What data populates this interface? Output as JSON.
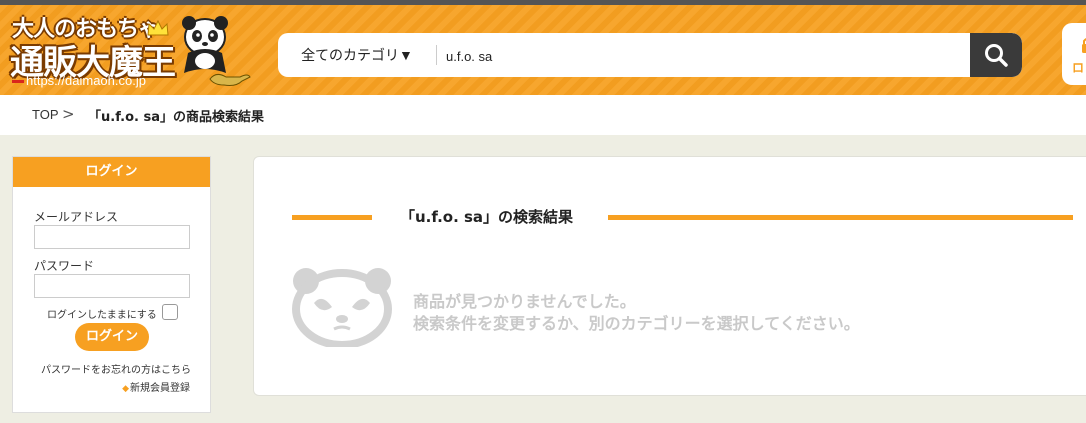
{
  "header": {
    "logo_line1": "大人のおもちゃ",
    "logo_line2": "通販大魔王",
    "logo_url": "https://daimaoh.co.jp",
    "category_select": "全てのカテゴリ▼",
    "search_value": "u.f.o. sa",
    "login_label": "ロ"
  },
  "breadcrumb": {
    "top": "TOP",
    "separator": ">",
    "current": "「u.f.o. sa」の商品検索結果"
  },
  "sidebar": {
    "title": "ログイン",
    "email_label": "メールアドレス",
    "password_label": "パスワード",
    "remember_label": "ログインしたままにする",
    "login_button": "ログイン",
    "forgot_link": "パスワードをお忘れの方はこちら",
    "signup_link": "新規会員登録"
  },
  "results": {
    "title": "「u.f.o. sa」の検索結果",
    "empty_line1": "商品が見つかりませんでした。",
    "empty_line2": "検索条件を変更するか、別のカテゴリーを選択してください。"
  },
  "colors": {
    "accent": "#f7a021",
    "search_button": "#3a3a3a",
    "background": "#eeeee3"
  },
  "icons": [
    "search-icon",
    "panda-icon",
    "crown-icon",
    "lamp-icon",
    "sad-panda-icon"
  ]
}
